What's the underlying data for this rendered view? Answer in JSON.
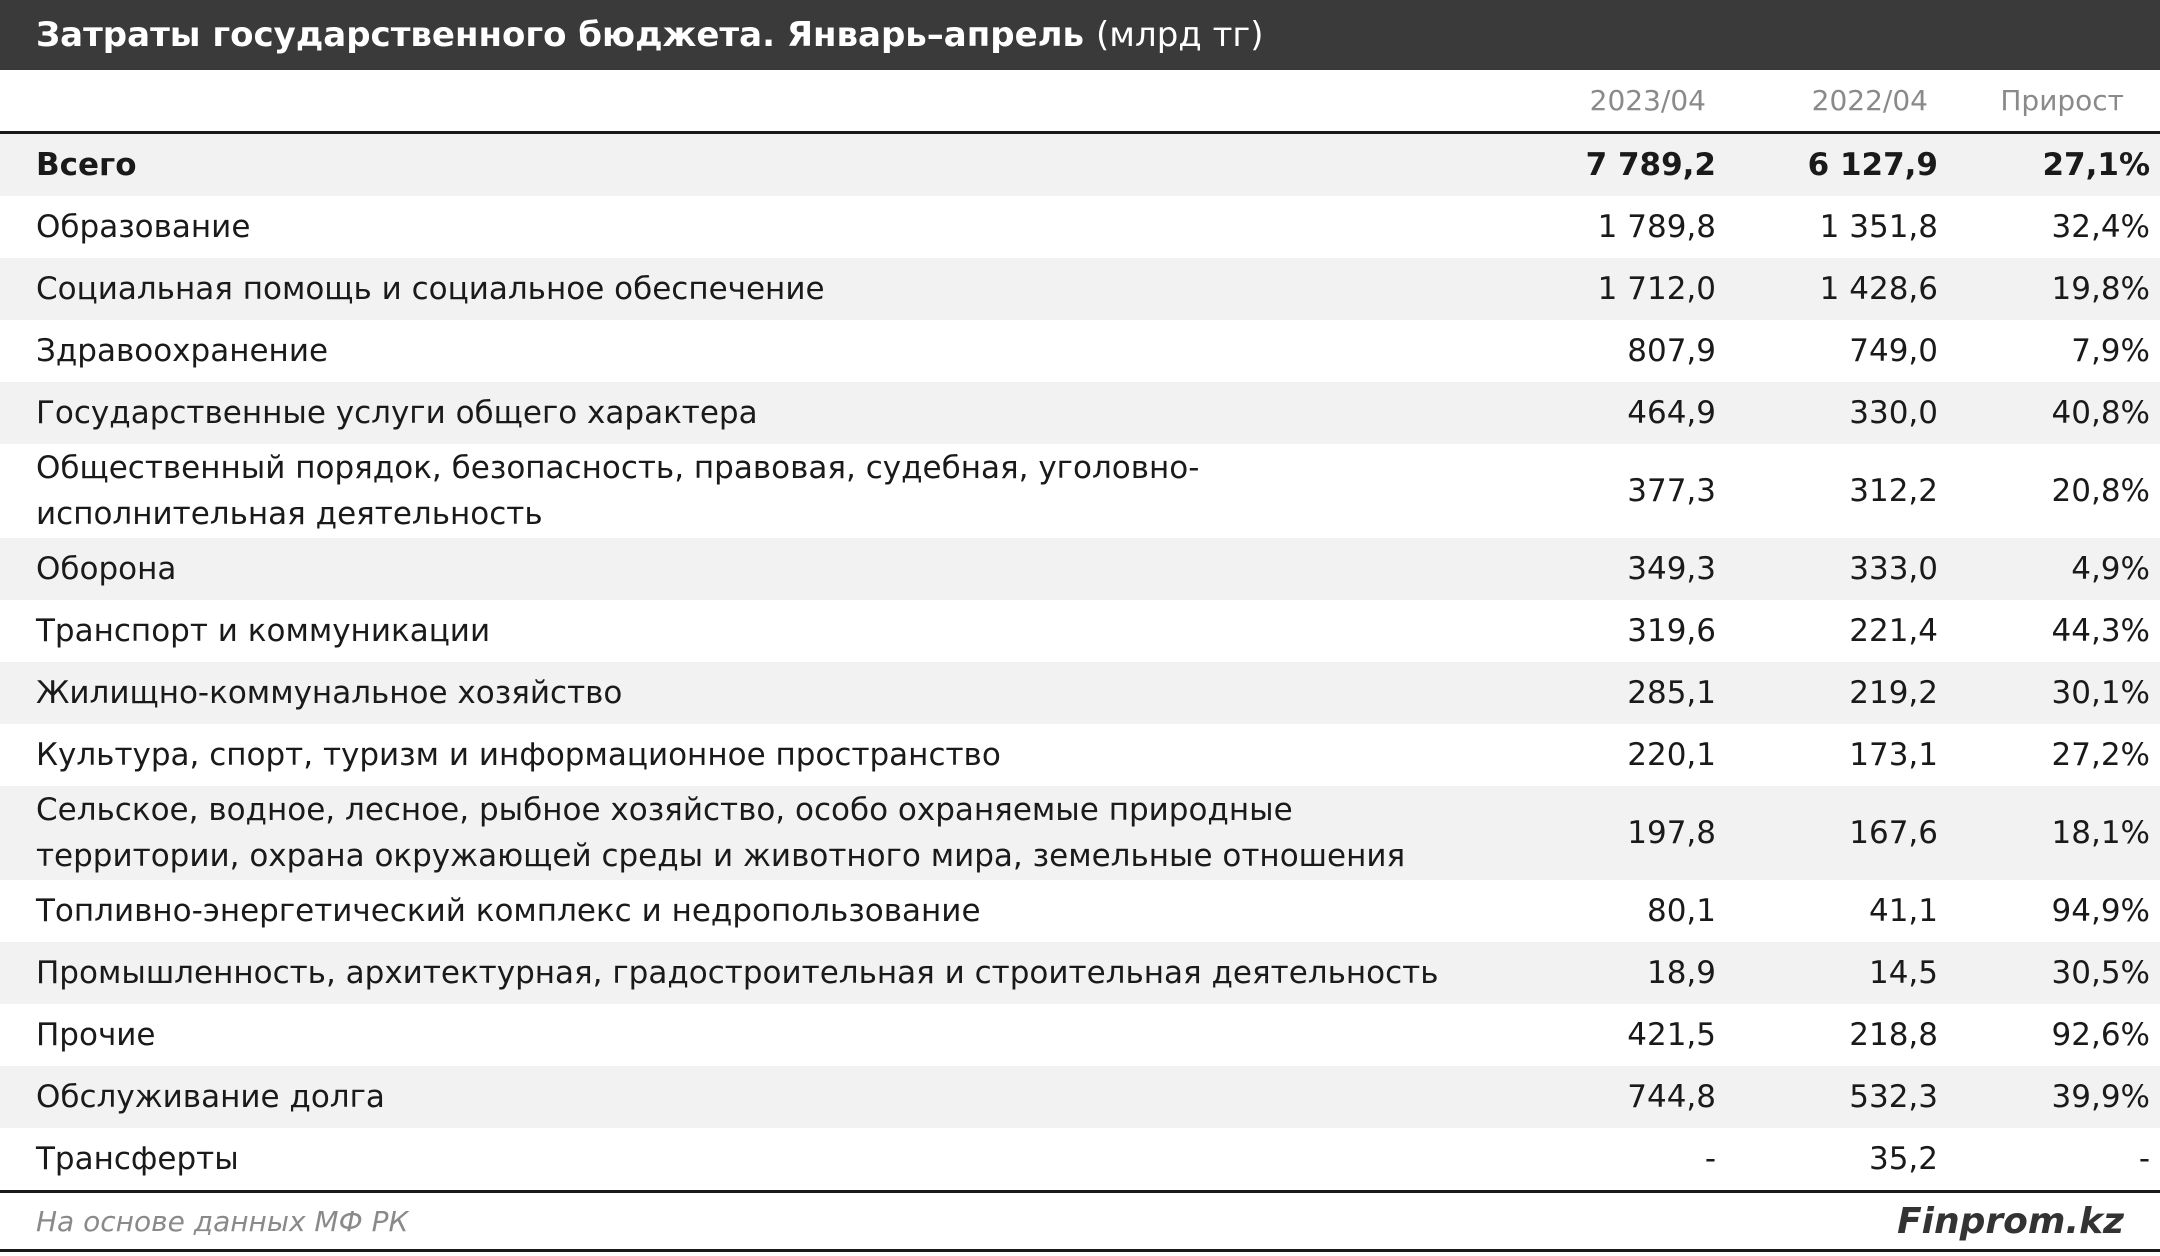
{
  "header": {
    "title": "Затраты государственного бюджета. Январь–апрель",
    "unit": "(млрд тг)"
  },
  "columns": {
    "col1": "2023/04",
    "col2": "2022/04",
    "col3": "Прирост"
  },
  "rows": [
    {
      "name": "Всего",
      "v2023": "7 789,2",
      "v2022": "6 127,9",
      "growth": "27,1%"
    },
    {
      "name": "Образование",
      "v2023": "1 789,8",
      "v2022": "1 351,8",
      "growth": "32,4%"
    },
    {
      "name": "Социальная помощь и социальное обеспечение",
      "v2023": "1 712,0",
      "v2022": "1 428,6",
      "growth": "19,8%"
    },
    {
      "name": "Здравоохранение",
      "v2023": "807,9",
      "v2022": "749,0",
      "growth": "7,9%"
    },
    {
      "name": "Государственные услуги общего характера",
      "v2023": "464,9",
      "v2022": "330,0",
      "growth": "40,8%"
    },
    {
      "name": "Общественный порядок, безопасность, правовая, судебная, уголовно-исполнительная деятельность",
      "v2023": "377,3",
      "v2022": "312,2",
      "growth": "20,8%"
    },
    {
      "name": "Оборона",
      "v2023": "349,3",
      "v2022": "333,0",
      "growth": "4,9%"
    },
    {
      "name": "Транспорт и коммуникации",
      "v2023": "319,6",
      "v2022": "221,4",
      "growth": "44,3%"
    },
    {
      "name": "Жилищно-коммунальное хозяйство",
      "v2023": "285,1",
      "v2022": "219,2",
      "growth": "30,1%"
    },
    {
      "name": "Культура, спорт, туризм и информационное пространство",
      "v2023": "220,1",
      "v2022": "173,1",
      "growth": "27,2%"
    },
    {
      "name": "Сельское, водное, лесное, рыбное хозяйство, особо охраняемые природные территории, охрана окружающей среды и животного мира, земельные отношения",
      "v2023": "197,8",
      "v2022": "167,6",
      "growth": "18,1%"
    },
    {
      "name": "Топливно-энергетический комплекс и недропользование",
      "v2023": "80,1",
      "v2022": "41,1",
      "growth": "94,9%"
    },
    {
      "name": "Промышленность, архитектурная, градостроительная и строительная деятельность",
      "v2023": "18,9",
      "v2022": "14,5",
      "growth": "30,5%"
    },
    {
      "name": "Прочие",
      "v2023": "421,5",
      "v2022": "218,8",
      "growth": "92,6%"
    },
    {
      "name": "Обслуживание долга",
      "v2023": "744,8",
      "v2022": "532,3",
      "growth": "39,9%"
    },
    {
      "name": "Трансферты",
      "v2023": "-",
      "v2022": "35,2",
      "growth": "-"
    }
  ],
  "footer": {
    "source": "На основе данных МФ РК",
    "brand": "Finprom.kz"
  },
  "colors": {
    "title_bg": "#3a3a3a",
    "stripe": "#f2f2f2"
  },
  "chart_data": {
    "type": "table",
    "title": "Затраты государственного бюджета. Январь–апрель",
    "unit": "(млрд тг)",
    "columns": [
      "2023/04",
      "2022/04",
      "Прирост"
    ],
    "categories": [
      "Всего",
      "Образование",
      "Социальная помощь и социальное обеспечение",
      "Здравоохранение",
      "Государственные услуги общего характера",
      "Общественный порядок, безопасность, правовая, судебная, уголовно-исполнительная деятельность",
      "Оборона",
      "Транспорт и коммуникации",
      "Жилищно-коммунальное хозяйство",
      "Культура, спорт, туризм и информационное пространство",
      "Сельское, водное, лесное, рыбное хозяйство, особо охраняемые природные территории, охрана окружающей среды и животного мира, земельные отношения",
      "Топливно-энергетический комплекс и недропользование",
      "Промышленность, архитектурная, градостроительная и строительная деятельность",
      "Прочие",
      "Обслуживание долга",
      "Трансферты"
    ],
    "series": [
      {
        "name": "2023/04",
        "values": [
          7789.2,
          1789.8,
          1712.0,
          807.9,
          464.9,
          377.3,
          349.3,
          319.6,
          285.1,
          220.1,
          197.8,
          80.1,
          18.9,
          421.5,
          744.8,
          null
        ]
      },
      {
        "name": "2022/04",
        "values": [
          6127.9,
          1351.8,
          1428.6,
          749.0,
          330.0,
          312.2,
          333.0,
          221.4,
          219.2,
          173.1,
          167.6,
          41.1,
          14.5,
          218.8,
          532.3,
          35.2
        ]
      },
      {
        "name": "Прирост",
        "values": [
          27.1,
          32.4,
          19.8,
          7.9,
          40.8,
          20.8,
          4.9,
          44.3,
          30.1,
          27.2,
          18.1,
          94.9,
          30.5,
          92.6,
          39.9,
          null
        ]
      }
    ]
  }
}
